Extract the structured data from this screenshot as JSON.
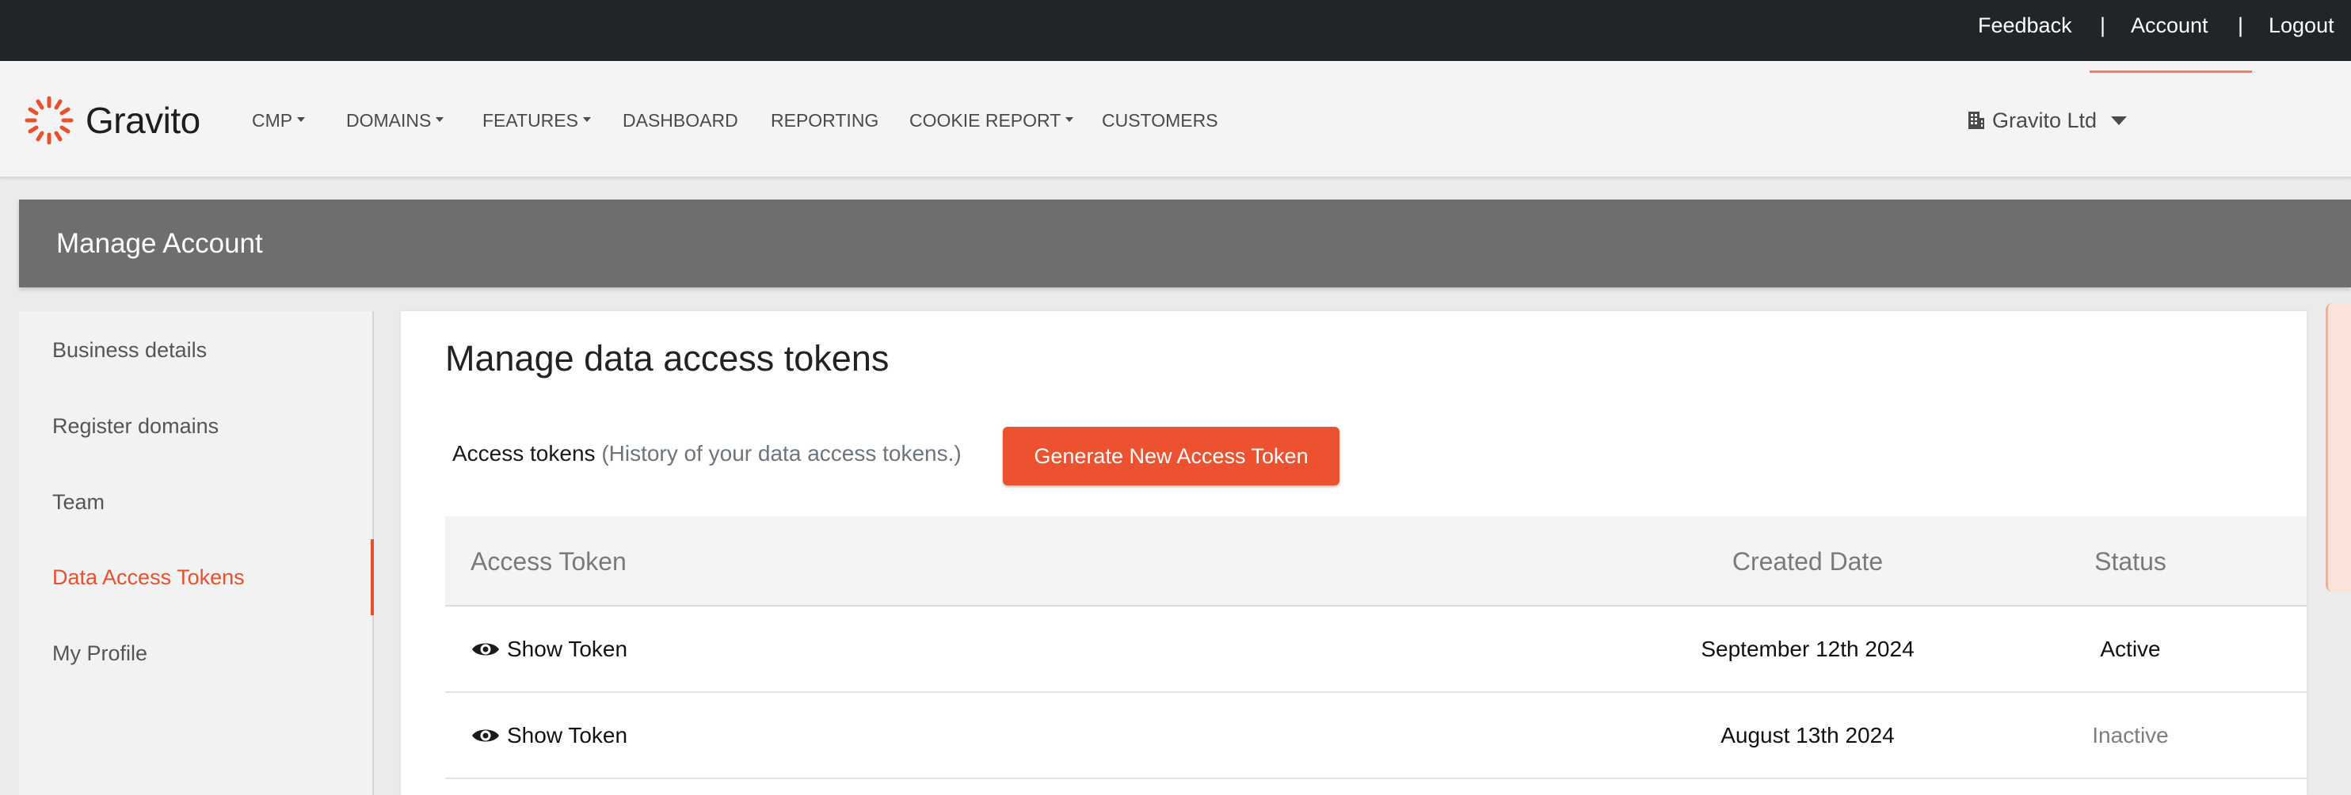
{
  "topbar": {
    "feedback": "Feedback",
    "account": "Account",
    "logout": "Logout",
    "separator": "|"
  },
  "brand": {
    "name": "Gravito",
    "accent_color": "#e8502e"
  },
  "nav": {
    "items": [
      {
        "label": "CMP",
        "dropdown": true
      },
      {
        "label": "DOMAINS",
        "dropdown": true
      },
      {
        "label": "FEATURES",
        "dropdown": true
      },
      {
        "label": "DASHBOARD",
        "dropdown": false
      },
      {
        "label": "REPORTING",
        "dropdown": false
      },
      {
        "label": "COOKIE REPORT",
        "dropdown": true
      },
      {
        "label": "CUSTOMERS",
        "dropdown": false
      }
    ],
    "organization": "Gravito Ltd"
  },
  "manage": {
    "title": "Manage Account"
  },
  "sidebar": {
    "items": [
      {
        "label": "Business details"
      },
      {
        "label": "Register domains"
      },
      {
        "label": "Team"
      },
      {
        "label": "Data Access Tokens",
        "active": true
      },
      {
        "label": "My Profile"
      }
    ]
  },
  "content": {
    "heading": "Manage data access tokens",
    "tokens_label": "Access tokens",
    "tokens_hint": "(History of your data access tokens.)",
    "generate_button": "Generate New Access Token",
    "table": {
      "headers": [
        "Access Token",
        "Created Date",
        "Status"
      ],
      "rows": [
        {
          "token": "Show Token",
          "created": "September 12th 2024",
          "status": "Active"
        },
        {
          "token": "Show Token",
          "created": "August 13th 2024",
          "status": "Inactive"
        }
      ]
    }
  }
}
